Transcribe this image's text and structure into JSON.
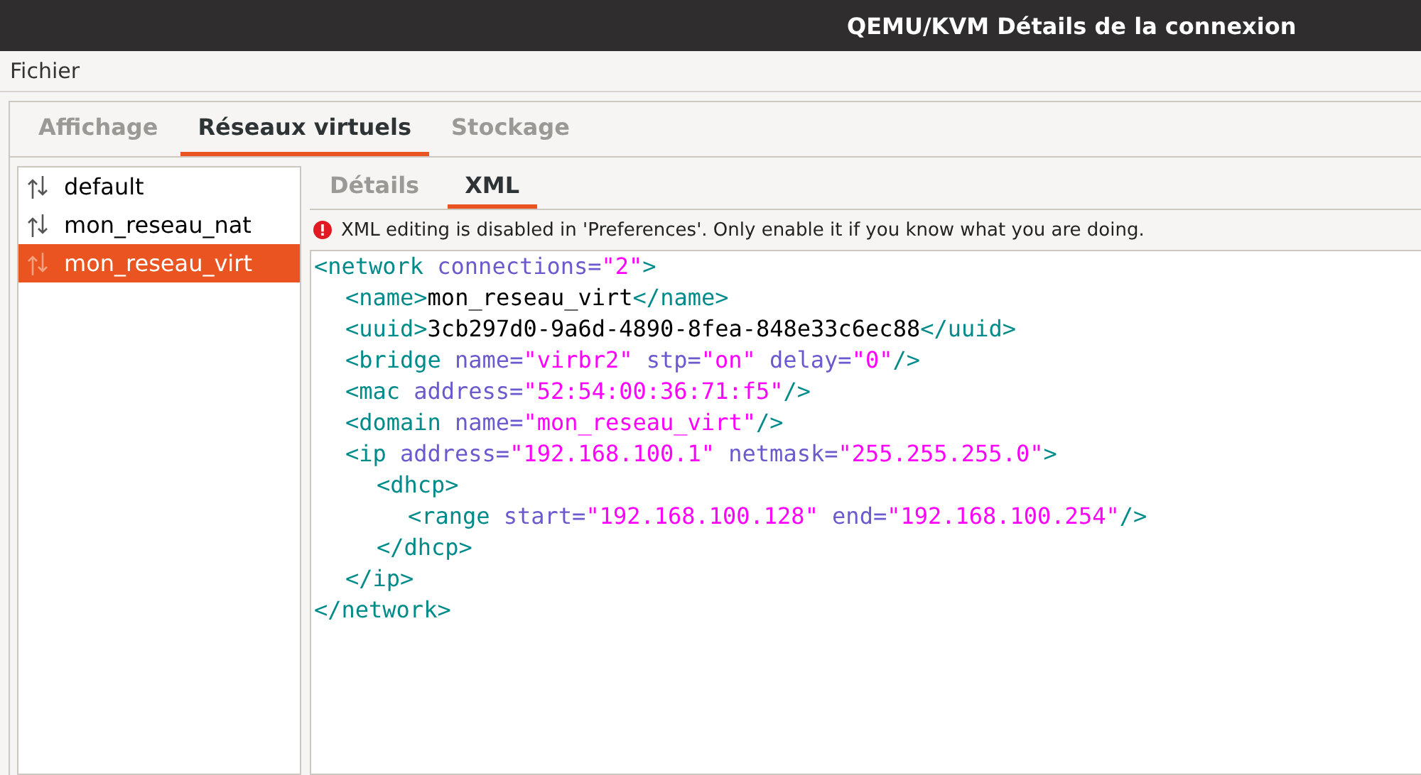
{
  "window": {
    "title": "QEMU/KVM Détails de la connexion"
  },
  "menu": [
    "Fichier"
  ],
  "tabs": [
    {
      "label": "Affichage",
      "selected": false
    },
    {
      "label": "Réseaux virtuels",
      "selected": true
    },
    {
      "label": "Stockage",
      "selected": false
    }
  ],
  "networks": [
    {
      "name": "default",
      "selected": false
    },
    {
      "name": "mon_reseau_nat",
      "selected": false
    },
    {
      "name": "mon_reseau_virt",
      "selected": true
    }
  ],
  "subtabs": [
    {
      "label": "Détails",
      "selected": false
    },
    {
      "label": "XML",
      "selected": true
    }
  ],
  "warning": "XML editing is disabled in 'Preferences'. Only enable it if you know what you are doing.",
  "xml": [
    {
      "tokens": [
        {
          "kind": "tag",
          "text": "<network"
        },
        {
          "kind": "attr",
          "text": "connections="
        },
        {
          "kind": "value",
          "text": "\"2\""
        },
        {
          "kind": "tag",
          "text": ">"
        }
      ],
      "children": [
        {
          "tokens": [
            {
              "kind": "tag",
              "text": "<name>"
            },
            {
              "kind": "text",
              "text": "mon_reseau_virt"
            },
            {
              "kind": "tag",
              "text": "</name>"
            }
          ]
        },
        {
          "tokens": [
            {
              "kind": "tag",
              "text": "<uuid>"
            },
            {
              "kind": "text",
              "text": "3cb297d0-9a6d-4890-8fea-848e33c6ec88"
            },
            {
              "kind": "tag",
              "text": "</uuid>"
            }
          ]
        },
        {
          "tokens": [
            {
              "kind": "tag",
              "text": "<bridge"
            },
            {
              "kind": "attr",
              "text": "name="
            },
            {
              "kind": "value",
              "text": "\"virbr2\""
            },
            {
              "kind": "attr",
              "text": "stp="
            },
            {
              "kind": "value",
              "text": "\"on\""
            },
            {
              "kind": "attr",
              "text": "delay="
            },
            {
              "kind": "value",
              "text": "\"0\""
            },
            {
              "kind": "tag",
              "text": "/>"
            }
          ]
        },
        {
          "tokens": [
            {
              "kind": "tag",
              "text": "<mac"
            },
            {
              "kind": "attr",
              "text": "address="
            },
            {
              "kind": "value",
              "text": "\"52:54:00:36:71:f5\""
            },
            {
              "kind": "tag",
              "text": "/>"
            }
          ]
        },
        {
          "tokens": [
            {
              "kind": "tag",
              "text": "<domain"
            },
            {
              "kind": "attr",
              "text": "name="
            },
            {
              "kind": "value",
              "text": "\"mon_reseau_virt\""
            },
            {
              "kind": "tag",
              "text": "/>"
            }
          ]
        },
        {
          "tokens": [
            {
              "kind": "tag",
              "text": "<ip"
            },
            {
              "kind": "attr",
              "text": "address="
            },
            {
              "kind": "value",
              "text": "\"192.168.100.1\""
            },
            {
              "kind": "attr",
              "text": "netmask="
            },
            {
              "kind": "value",
              "text": "\"255.255.255.0\""
            },
            {
              "kind": "tag",
              "text": ">"
            }
          ],
          "children": [
            {
              "tokens": [
                {
                  "kind": "tag",
                  "text": "<dhcp>"
                }
              ],
              "children": [
                {
                  "tokens": [
                    {
                      "kind": "tag",
                      "text": "<range"
                    },
                    {
                      "kind": "attr",
                      "text": "start="
                    },
                    {
                      "kind": "value",
                      "text": "\"192.168.100.128\""
                    },
                    {
                      "kind": "attr",
                      "text": "end="
                    },
                    {
                      "kind": "value",
                      "text": "\"192.168.100.254\""
                    },
                    {
                      "kind": "tag",
                      "text": "/>"
                    }
                  ]
                }
              ],
              "close": [
                {
                  "kind": "tag",
                  "text": "</dhcp>"
                }
              ]
            }
          ],
          "close": [
            {
              "kind": "tag",
              "text": "</ip>"
            }
          ]
        }
      ],
      "close": [
        {
          "kind": "tag",
          "text": "</network>"
        }
      ]
    }
  ]
}
